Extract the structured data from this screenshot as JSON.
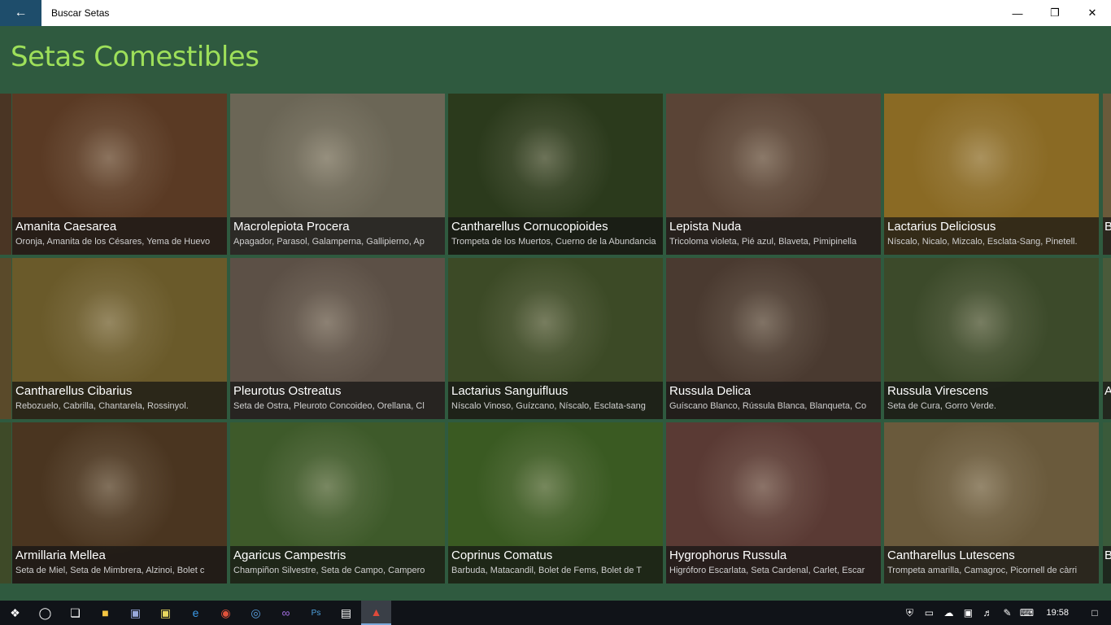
{
  "window": {
    "title": "Buscar Setas"
  },
  "page": {
    "title": "Setas Comestibles"
  },
  "tiles": [
    {
      "name": "Amanita Caesarea",
      "alt": "Oronja, Amanita de los Césares, Yema de Huevo",
      "color": "#5a3a24"
    },
    {
      "name": "Macrolepiota Procera",
      "alt": "Apagador, Parasol, Galamperna, Gallipierno, Ap",
      "color": "#6b6656"
    },
    {
      "name": "Cantharellus Cornucopioides",
      "alt": "Trompeta de los Muertos, Cuerno de la Abundancia",
      "color": "#2b3a1c"
    },
    {
      "name": "Lepista Nuda",
      "alt": "Tricoloma violeta, Pié azul, Blaveta, Pimipinella",
      "color": "#5a4436"
    },
    {
      "name": "Lactarius Deliciosus",
      "alt": "Níscalo, Nicalo, Mizcalo, Esclata-Sang, Pinetell.",
      "color": "#8a6a24"
    },
    {
      "name": "Cantharellus Cibarius",
      "alt": "Rebozuelo, Cabrilla, Chantarela, Rossinyol.",
      "color": "#6a5a2a"
    },
    {
      "name": "Pleurotus Ostreatus",
      "alt": "Seta de Ostra, Pleuroto Concoideo, Orellana, Cl",
      "color": "#5c5046"
    },
    {
      "name": "Lactarius Sanguifluus",
      "alt": "Níscalo Vinoso, Guízcano, Níscalo, Esclata-sang",
      "color": "#3c4a26"
    },
    {
      "name": "Russula Delica",
      "alt": "Guíscano Blanco, Rússula Blanca, Blanqueta, Co",
      "color": "#4a3a30"
    },
    {
      "name": "Russula Virescens",
      "alt": "Seta de Cura, Gorro Verde.",
      "color": "#3c4a2a"
    },
    {
      "name": "Armillaria Mellea",
      "alt": "Seta de Miel, Seta de Mimbrera, Alzinoi, Bolet c",
      "color": "#4a3520"
    },
    {
      "name": "Agaricus Campestris",
      "alt": "Champiñon Silvestre, Seta de Campo, Campero",
      "color": "#3e5a2a"
    },
    {
      "name": "Coprinus Comatus",
      "alt": "Barbuda, Matacandil, Bolet de Fems, Bolet de T",
      "color": "#3a5a22"
    },
    {
      "name": "Hygrophorus Russula",
      "alt": "Higróforo Escarlata, Seta Cardenal, Carlet, Escar",
      "color": "#5a3a34"
    },
    {
      "name": "Cantharellus Lutescens",
      "alt": "Trompeta amarilla, Camagroc, Picornell de càrri",
      "color": "#6a5a3c"
    }
  ],
  "partial_right": [
    "B",
    "A",
    "B"
  ],
  "taskbar": {
    "clock": "19:58"
  }
}
